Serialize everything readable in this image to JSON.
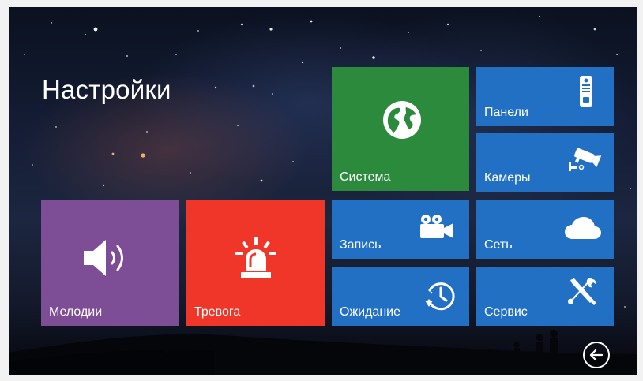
{
  "title": "Настройки",
  "tiles": {
    "system": {
      "label": "Система",
      "icon": "globe-icon",
      "color": "#2c8a3d"
    },
    "panels": {
      "label": "Панели",
      "icon": "doorbell-panel-icon",
      "color": "#2170c4"
    },
    "cameras": {
      "label": "Камеры",
      "icon": "cctv-camera-icon",
      "color": "#2170c4"
    },
    "record": {
      "label": "Запись",
      "icon": "video-camera-icon",
      "color": "#2170c4"
    },
    "network": {
      "label": "Сеть",
      "icon": "cloud-icon",
      "color": "#2170c4"
    },
    "standby": {
      "label": "Ожидание",
      "icon": "clock-history-icon",
      "color": "#2170c4"
    },
    "service": {
      "label": "Сервис",
      "icon": "tools-icon",
      "color": "#2170c4"
    },
    "melodies": {
      "label": "Мелодии",
      "icon": "speaker-icon",
      "color": "#7d4e96"
    },
    "alarm": {
      "label": "Тревога",
      "icon": "alarm-siren-icon",
      "color": "#ef3629"
    }
  },
  "back": {
    "icon": "back-arrow-icon"
  }
}
